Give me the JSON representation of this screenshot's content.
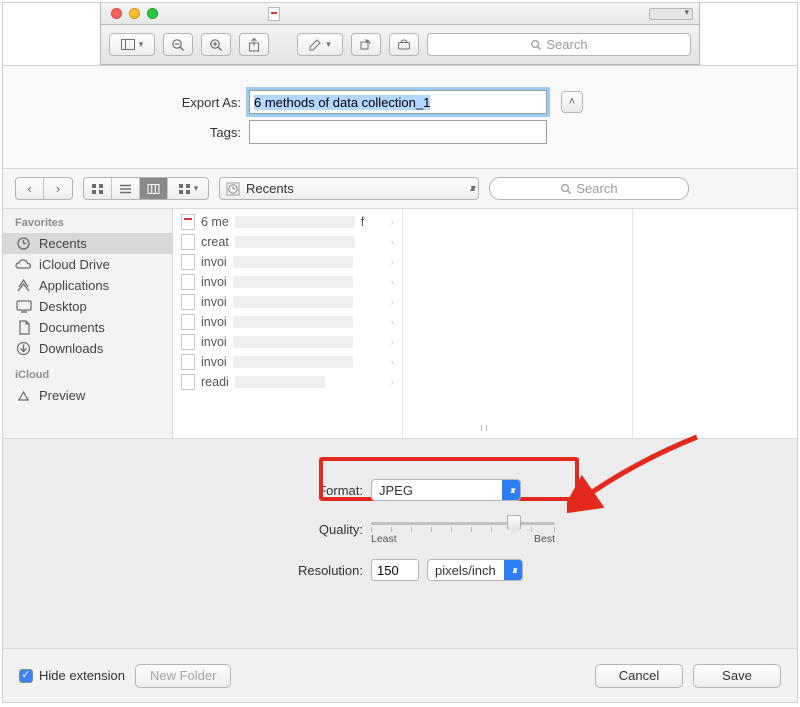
{
  "titlebar": {
    "doc_redacted": ""
  },
  "apptoolbar": {
    "search_placeholder": "Search"
  },
  "export": {
    "export_as_label": "Export As:",
    "export_as_value": "6 methods of data collection_1",
    "tags_label": "Tags:",
    "tags_value": ""
  },
  "finder_bar": {
    "location": "Recents",
    "search_placeholder": "Search"
  },
  "sidebar": {
    "sections": [
      {
        "header": "Favorites",
        "items": [
          {
            "icon": "clock-icon",
            "label": "Recents",
            "selected": true
          },
          {
            "icon": "cloud-icon",
            "label": "iCloud Drive"
          },
          {
            "icon": "apps-icon",
            "label": "Applications"
          },
          {
            "icon": "desktop-icon",
            "label": "Desktop"
          },
          {
            "icon": "documents-icon",
            "label": "Documents"
          },
          {
            "icon": "downloads-icon",
            "label": "Downloads"
          }
        ]
      },
      {
        "header": "iCloud",
        "items": [
          {
            "icon": "preview-icon",
            "label": "Preview"
          }
        ]
      }
    ]
  },
  "files": {
    "column1": [
      {
        "type": "pdf",
        "prefix": "6 me",
        "suffix": "f"
      },
      {
        "type": "doc",
        "prefix": "creat"
      },
      {
        "type": "doc",
        "prefix": "invoi"
      },
      {
        "type": "doc",
        "prefix": "invoi"
      },
      {
        "type": "doc",
        "prefix": "invoi"
      },
      {
        "type": "doc",
        "prefix": "invoi"
      },
      {
        "type": "doc",
        "prefix": "invoi"
      },
      {
        "type": "doc",
        "prefix": "invoi"
      },
      {
        "type": "doc",
        "prefix": "readi"
      }
    ]
  },
  "options": {
    "format_label": "Format:",
    "format_value": "JPEG",
    "quality_label": "Quality:",
    "quality_least": "Least",
    "quality_best": "Best",
    "resolution_label": "Resolution:",
    "resolution_value": "150",
    "resolution_unit": "pixels/inch"
  },
  "footer": {
    "hide_ext_label": "Hide extension",
    "hide_ext_checked": true,
    "new_folder": "New Folder",
    "cancel": "Cancel",
    "save": "Save"
  }
}
